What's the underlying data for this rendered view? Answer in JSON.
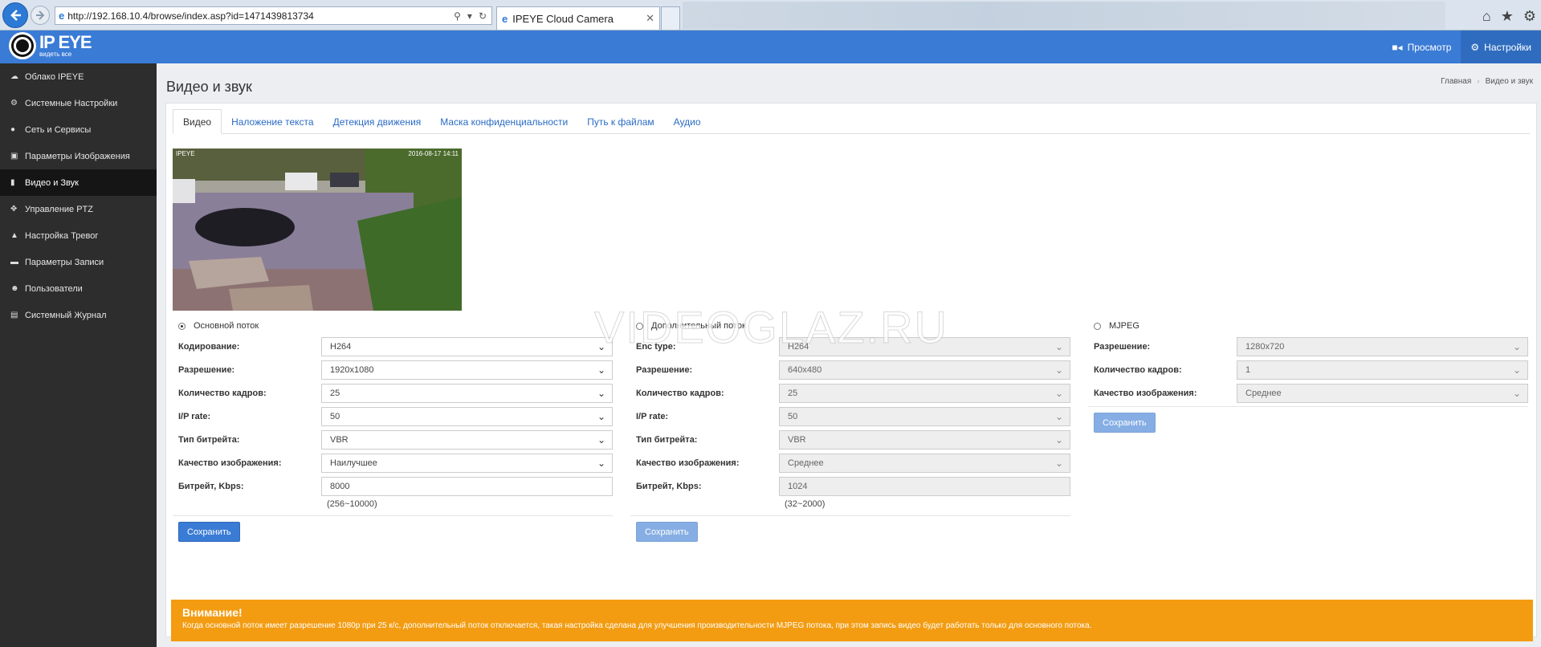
{
  "browser": {
    "url": "http://192.168.10.4/browse/index.asp?id=1471439813734",
    "tab_title": "IPEYE Cloud Camera"
  },
  "logo": {
    "brand": "IP EYE",
    "slogan": "видеть все"
  },
  "top_nav": [
    {
      "label": "Просмотр",
      "icon": "camera-icon"
    },
    {
      "label": "Настройки",
      "icon": "gear-icon"
    }
  ],
  "sidebar": {
    "items": [
      {
        "label": "Облако IPEYE",
        "icon": "cloud-icon"
      },
      {
        "label": "Системные Настройки",
        "icon": "settings-icon"
      },
      {
        "label": "Сеть и Сервисы",
        "icon": "globe-icon"
      },
      {
        "label": "Параметры Изображения",
        "icon": "image-icon"
      },
      {
        "label": "Видео и Звук",
        "icon": "video-icon",
        "active": true
      },
      {
        "label": "Управление PTZ",
        "icon": "move-icon"
      },
      {
        "label": "Настройка Тревог",
        "icon": "warning-icon"
      },
      {
        "label": "Параметры Записи",
        "icon": "record-icon"
      },
      {
        "label": "Пользователи",
        "icon": "users-icon"
      },
      {
        "label": "Системный Журнал",
        "icon": "log-icon"
      }
    ]
  },
  "page": {
    "title": "Видео и звук",
    "breadcrumb": [
      "Главная",
      "Видео и звук"
    ]
  },
  "tabs": [
    "Видео",
    "Наложение текста",
    "Детекция движения",
    "Маска конфиденциальности",
    "Путь к файлам",
    "Аудио"
  ],
  "preview": {
    "camera_name": "IPEYE",
    "timestamp": "2016-08-17 14:11"
  },
  "main_stream": {
    "title": "Основной поток",
    "fields": [
      {
        "label": "Кодирование:",
        "value": "H264"
      },
      {
        "label": "Разрешение:",
        "value": "1920x1080"
      },
      {
        "label": "Количество кадров:",
        "value": "25"
      },
      {
        "label": "I/P rate:",
        "value": "50"
      },
      {
        "label": "Тип битрейта:",
        "value": "VBR"
      },
      {
        "label": "Качество изображения:",
        "value": "Наилучшее"
      }
    ],
    "bitrate_label": "Битрейт, Kbps:",
    "bitrate_value": "8000",
    "bitrate_hint": "(256~10000)",
    "save": "Сохранить"
  },
  "sub_stream": {
    "title": "Дополнительный поток",
    "fields": [
      {
        "label": "Enc type:",
        "value": "H264"
      },
      {
        "label": "Разрешение:",
        "value": "640x480"
      },
      {
        "label": "Количество кадров:",
        "value": "25"
      },
      {
        "label": "I/P rate:",
        "value": "50"
      },
      {
        "label": "Тип битрейта:",
        "value": "VBR"
      },
      {
        "label": "Качество изображения:",
        "value": "Среднее"
      }
    ],
    "bitrate_label": "Битрейт, Kbps:",
    "bitrate_value": "1024",
    "bitrate_hint": "(32~2000)",
    "save": "Сохранить"
  },
  "mjpeg_stream": {
    "title": "MJPEG",
    "fields": [
      {
        "label": "Разрешение:",
        "value": "1280x720"
      },
      {
        "label": "Количество кадров:",
        "value": "1"
      },
      {
        "label": "Качество изображения:",
        "value": "Среднее"
      }
    ],
    "save": "Сохранить"
  },
  "alert": {
    "title": "Внимание!",
    "text": "Когда основной поток имеет разрешение 1080р при 25 к/с, дополнительный поток отключается, такая настройка сделана для улучшения производительности MJPEG потока, при этом запись видео будет работать только для основного потока."
  },
  "watermark": "VIDEOGLAZ.RU",
  "colors": {
    "primary": "#3a7bd5",
    "sidebar": "#2d2d2d",
    "warning": "#f39c12"
  }
}
